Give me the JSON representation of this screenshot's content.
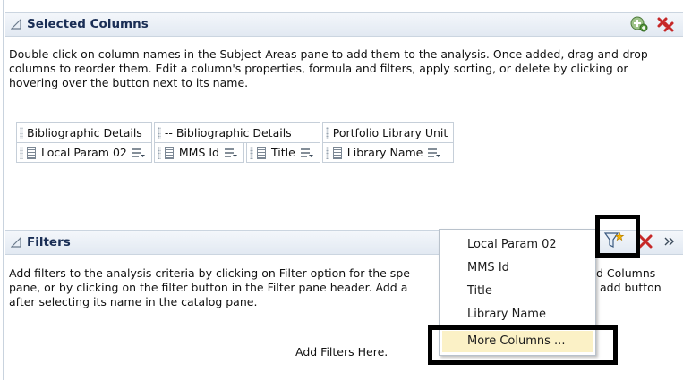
{
  "selected_columns": {
    "title": "Selected Columns",
    "description": "Double click on column names in the Subject Areas pane to add them to the analysis. Once added, drag-and-drop columns to reorder them. Edit a column's properties, formula and filters, apply sorting, or delete by clicking or hovering over the button next to its name.",
    "groups": [
      {
        "name": "Bibliographic Details",
        "columns": [
          "Local Param 02"
        ]
      },
      {
        "name": "-- Bibliographic Details",
        "columns": [
          "MMS Id",
          "Title"
        ]
      },
      {
        "name": "Portfolio Library Unit",
        "columns": [
          "Library Name"
        ]
      }
    ]
  },
  "filters": {
    "title": "Filters",
    "line1_start": "Add filters to the analysis criteria by clicking on Filter option for the spe",
    "line1_end": "d Columns",
    "line2_start": "pane, or by clicking on the filter button in the Filter pane header. Add a",
    "line2_end": "add button",
    "line3": "after selecting its name in the catalog pane.",
    "add_here": "Add Filters Here."
  },
  "filter_menu": {
    "items": [
      "Local Param 02",
      "MMS Id",
      "Title",
      "Library Name",
      "More Columns ..."
    ],
    "highlighted_index": 4
  },
  "colors": {
    "header_title": "#1a2e55",
    "highlight": "#fbf1c6",
    "callout": "#000000"
  },
  "icons": [
    "collapse-triangle-icon",
    "add-column-icon",
    "remove-all-icon",
    "column-menu-icon",
    "add-filter-icon",
    "expand-arrows-icon"
  ]
}
